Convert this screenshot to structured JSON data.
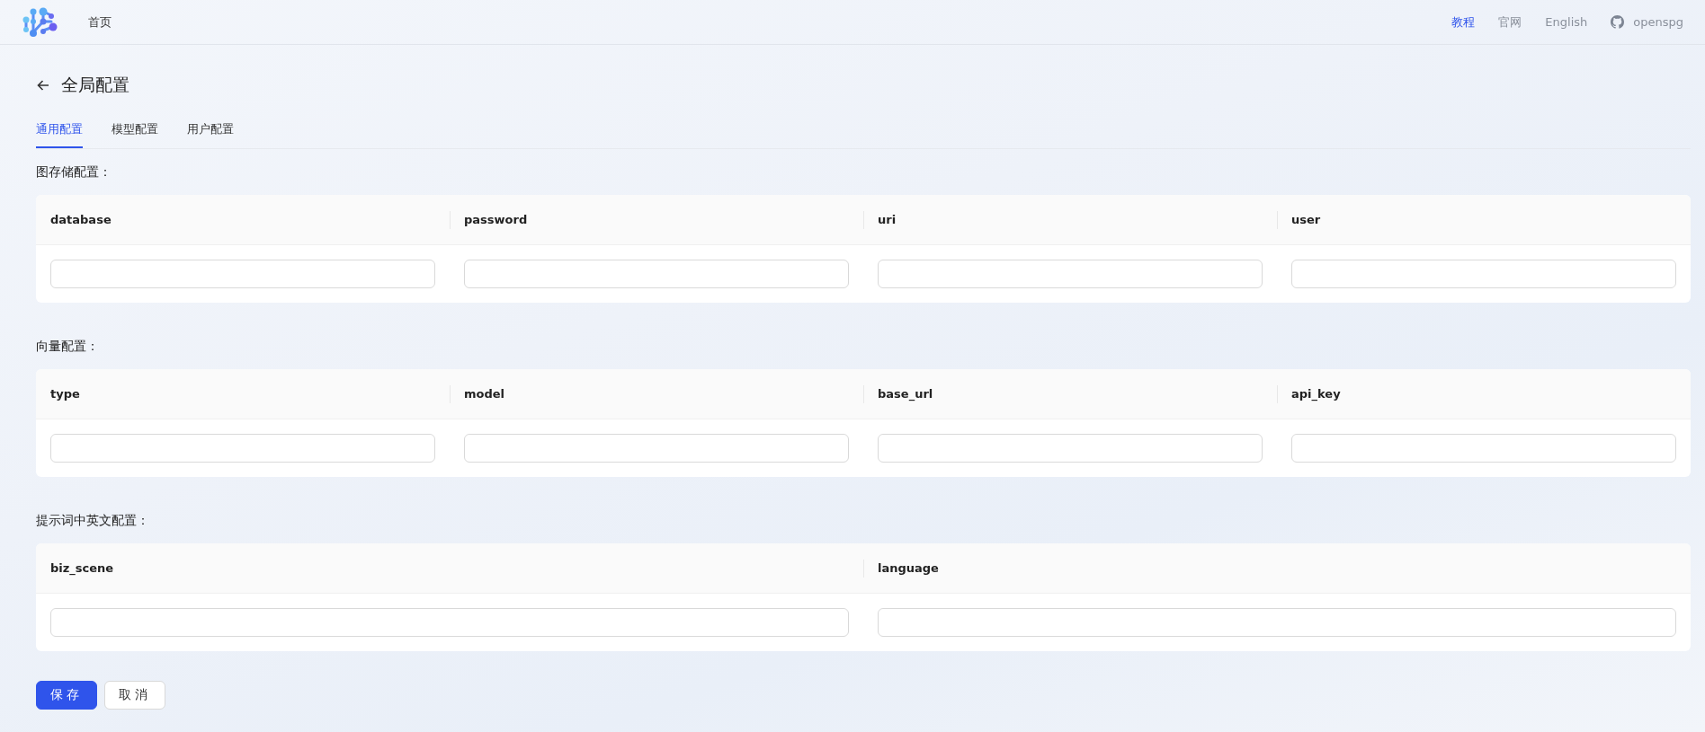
{
  "header": {
    "home_link": "首页",
    "links": [
      {
        "label": "教程",
        "selected": true,
        "kind": "text"
      },
      {
        "label": "官网",
        "selected": false,
        "kind": "text"
      },
      {
        "label": "English",
        "selected": false,
        "kind": "text"
      },
      {
        "label": "openspg",
        "selected": false,
        "kind": "github"
      }
    ]
  },
  "page_title": "全局配置",
  "tabs": [
    {
      "label": "通用配置",
      "selected": true
    },
    {
      "label": "模型配置",
      "selected": false
    },
    {
      "label": "用户配置",
      "selected": false
    }
  ],
  "sections": [
    {
      "title": "图存储配置：",
      "columns": [
        "database",
        "password",
        "uri",
        "user"
      ]
    },
    {
      "title": "向量配置：",
      "columns": [
        "type",
        "model",
        "base_url",
        "api_key"
      ]
    },
    {
      "title": "提示词中英文配置：",
      "columns": [
        "biz_scene",
        "language"
      ]
    }
  ],
  "buttons": [
    {
      "label": "保存",
      "kind": "primary"
    },
    {
      "label": "取消",
      "kind": "default"
    }
  ]
}
